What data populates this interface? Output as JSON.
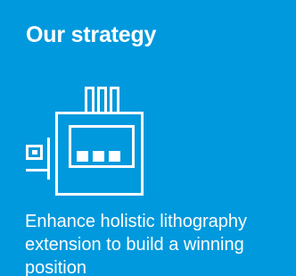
{
  "card": {
    "title": "Our strategy",
    "icon": "lithography-machine-icon",
    "description": "Enhance holistic lithography extension to build a winning position",
    "background_color": "#0099dd",
    "text_color": "#ffffff"
  }
}
